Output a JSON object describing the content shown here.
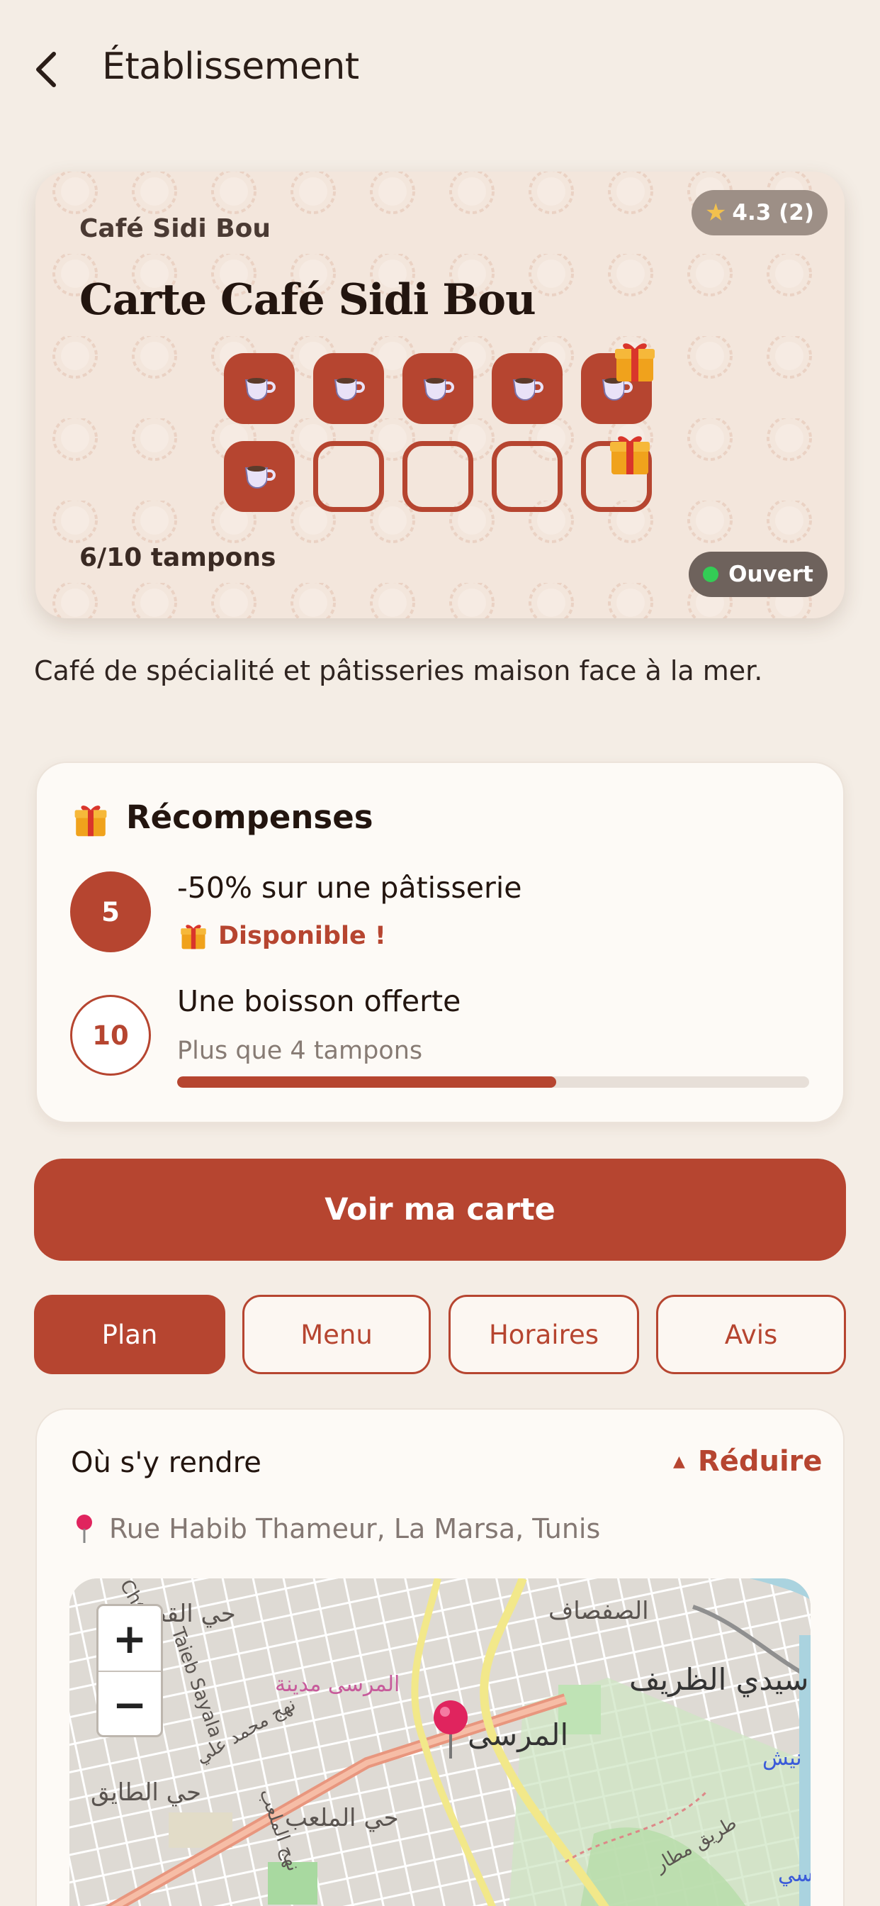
{
  "header": {
    "title": "Établissement"
  },
  "card": {
    "business_name": "Café Sidi Bou",
    "title": "Carte Café Sidi Bou",
    "rating": "4.3 (2)",
    "stamps_collected": 6,
    "stamps_total": 10,
    "stamp_count_text": "6/10 tampons",
    "status": "Ouvert",
    "accent": "#b64530"
  },
  "description": "Café de spécialité et pâtisseries maison face à la mer.",
  "rewards": {
    "title": "Récompenses",
    "items": [
      {
        "threshold": "5",
        "label": "-50% sur une pâtisserie",
        "status": "Disponible !"
      },
      {
        "threshold": "10",
        "label": "Une boisson offerte",
        "status": "Plus que 4 tampons",
        "progress": 0.6
      }
    ]
  },
  "primary_button": "Voir ma carte",
  "tabs": [
    {
      "label": "Plan",
      "active": true
    },
    {
      "label": "Menu",
      "active": false
    },
    {
      "label": "Horaires",
      "active": false
    },
    {
      "label": "Avis",
      "active": false
    }
  ],
  "directions": {
    "title": "Où s'y rendre",
    "collapse_label": "Réduire",
    "address": "Rue Habib Thameur, La Marsa, Tunis"
  },
  "map": {
    "zoom_in": "+",
    "zoom_out": "−",
    "labels": {
      "marsa": "المرسى",
      "sidi_dhrif": "سيدي الظريف",
      "safsaf": "الصفصاف",
      "qudat": "حي القضاة",
      "marsa_medina": "المرسى مدينة",
      "malaab": "حي الملعب",
      "taieb": "حي الطايق",
      "mohamed_ali": "نهج محمد علي",
      "malaab_st": "نهج الملعب",
      "chott": "Chott",
      "taieb_sayala": "Taieb Sayala",
      "matar": "طريق مطار",
      "nish": "نيش",
      "edge_si": "سي"
    }
  }
}
